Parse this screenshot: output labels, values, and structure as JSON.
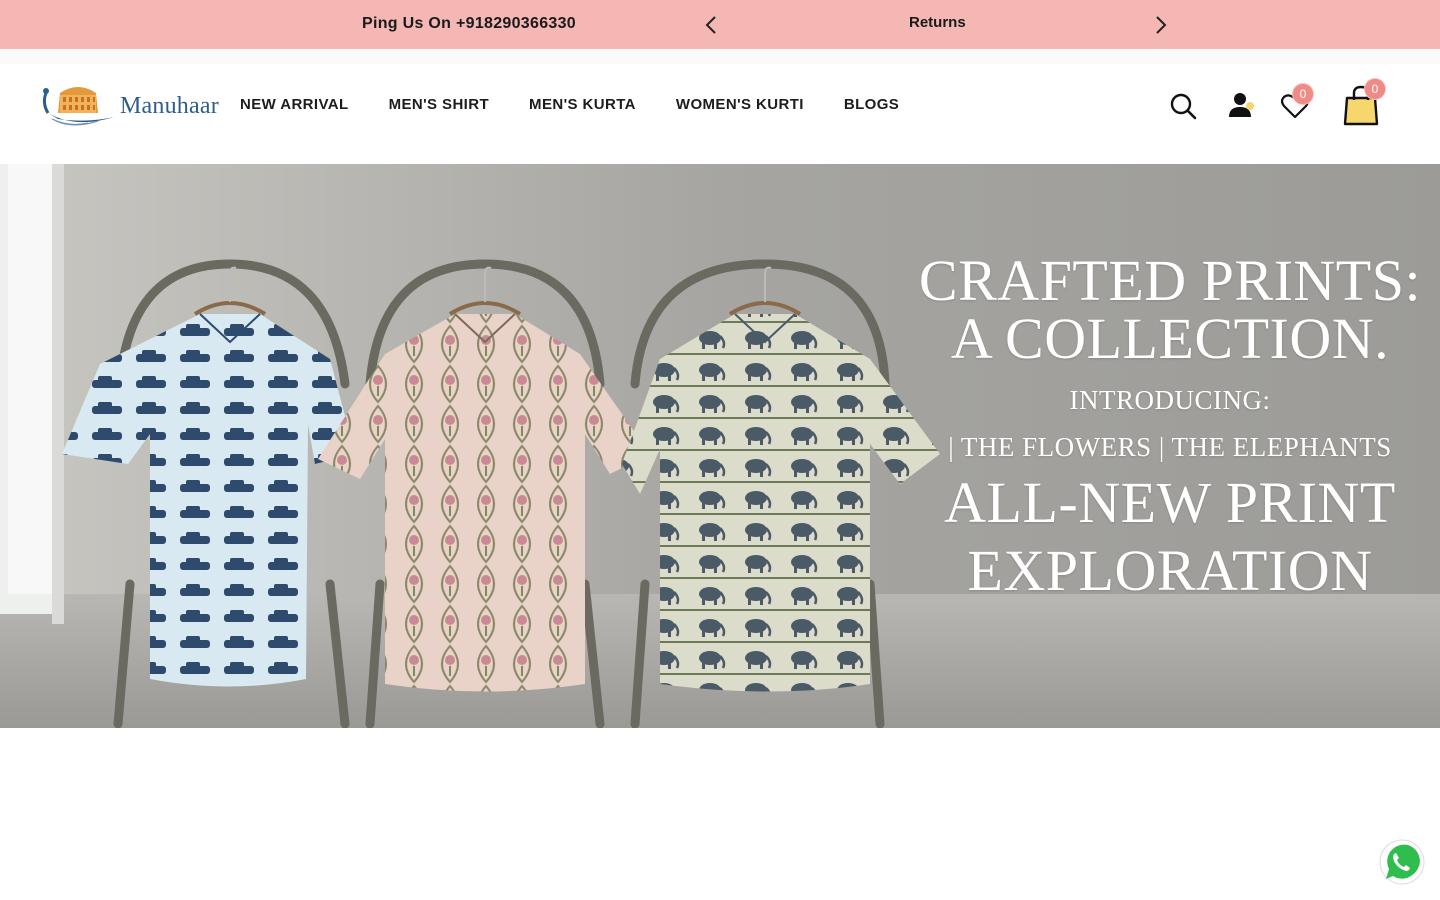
{
  "announcement": {
    "phone_text": "Ping Us On +918290366330",
    "message": "Returns",
    "prev_icon": "chevron-left-icon",
    "next_icon": "chevron-right-icon"
  },
  "header": {
    "logo_text": "Manuhaar",
    "nav": [
      {
        "label": "NEW ARRIVAL"
      },
      {
        "label": "MEN'S SHIRT"
      },
      {
        "label": "MEN'S KURTA"
      },
      {
        "label": "WOMEN'S KURTI"
      },
      {
        "label": "BLOGS"
      }
    ],
    "icons": {
      "search": "search-icon",
      "account": "user-icon",
      "wishlist": "heart-icon",
      "cart": "shopping-bag-icon"
    },
    "wishlist_count": "0",
    "cart_count": "0"
  },
  "hero": {
    "line1": "CRAFTED PRINTS:",
    "line2": "A COLLECTION.",
    "line3": "INTRODUCING:",
    "line4": "| THE FLOWERS | THE ELEPHANTS",
    "line5": "ALL-NEW PRINT",
    "line6": "EXPLORATION"
  },
  "floating": {
    "whatsapp_icon": "whatsapp-icon"
  },
  "colors": {
    "announcement_bg": "#f4b7b4",
    "badge": "#ef8b87",
    "logo_text": "#2f5d8a",
    "cart_bag": "#f5d76e"
  }
}
